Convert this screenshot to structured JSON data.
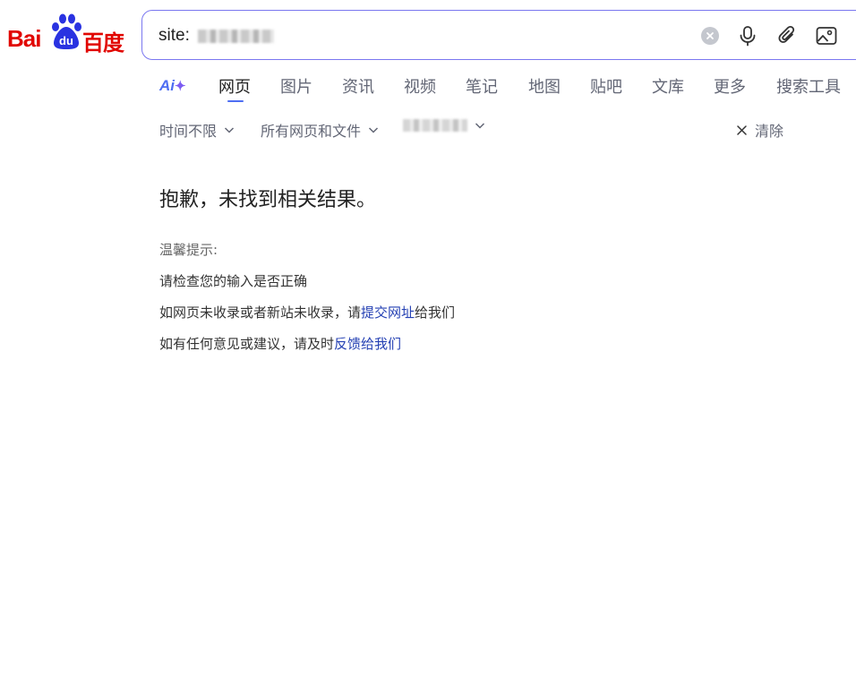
{
  "logo": {
    "text_left": "Bai",
    "text_paw": "du",
    "text_right": "百度",
    "brand_color": "#e10601",
    "paw_color": "#2932e1"
  },
  "search": {
    "value": "site:"
  },
  "tabs": {
    "ai_label": "Ai",
    "items": [
      "网页",
      "图片",
      "资讯",
      "视频",
      "笔记",
      "地图",
      "贴吧",
      "文库",
      "更多",
      "搜索工具"
    ],
    "active_index": 0,
    "active_color": "#4e6ef2"
  },
  "filters": {
    "time": "时间不限",
    "scope": "所有网页和文件",
    "clear": "清除"
  },
  "results": {
    "no_result": "抱歉，未找到相关结果。",
    "tip_title": "温馨提示:",
    "tip1": "请检查您的输入是否正确",
    "tip2_prefix": "如网页未收录或者新站未收录，请",
    "tip2_link": "提交网址",
    "tip2_suffix": "给我们",
    "tip3_prefix": "如有任何意见或建议，请及时",
    "tip3_link": "反馈给我们",
    "link_color": "#2440b3"
  },
  "icons": [
    "clear-icon",
    "microphone-icon",
    "attachment-icon",
    "image-search-icon",
    "chevron-down-icon",
    "close-icon"
  ]
}
